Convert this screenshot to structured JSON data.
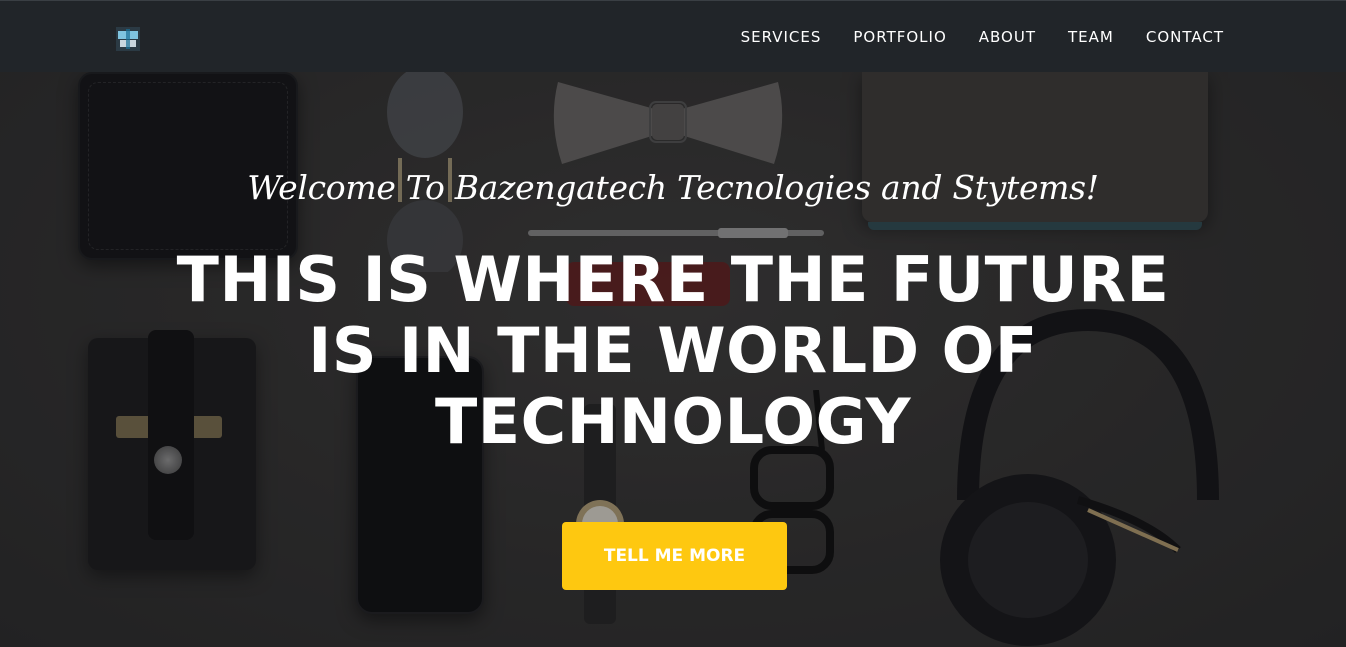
{
  "navbar": {
    "logo_icon": "company-logo-icon",
    "items": [
      {
        "label": "SERVICES"
      },
      {
        "label": "PORTFOLIO"
      },
      {
        "label": "ABOUT"
      },
      {
        "label": "TEAM"
      },
      {
        "label": "CONTACT"
      }
    ]
  },
  "hero": {
    "lead": "Welcome To Bazengatech Tecnologies and Stytems!",
    "heading_lines": [
      "THIS IS WHERE THE FUTURE",
      "IS IN THE WORLD OF",
      "TECHNOLOGY"
    ],
    "cta_label": "TELL ME MORE"
  },
  "colors": {
    "navbar_bg": "#212529",
    "accent": "#fec810",
    "text": "#ffffff"
  }
}
